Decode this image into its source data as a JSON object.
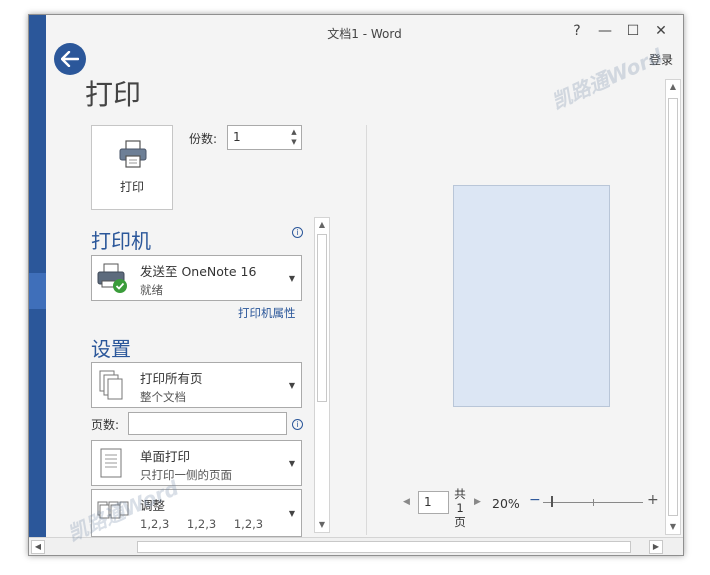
{
  "window": {
    "title": "文档1 - Word",
    "login": "登录",
    "help": "?",
    "minimize": "—",
    "maximize": "☐",
    "close": "✕"
  },
  "page": {
    "title": "打印"
  },
  "print_button": {
    "label": "打印"
  },
  "copies": {
    "label": "份数:",
    "value": "1"
  },
  "printer": {
    "heading": "打印机",
    "name": "发送至 OneNote 16",
    "status": "就绪",
    "properties_link": "打印机属性"
  },
  "settings": {
    "heading": "设置",
    "range": {
      "title": "打印所有页",
      "subtitle": "整个文档"
    },
    "pages_label": "页数:",
    "pages_value": "",
    "sides": {
      "title": "单面打印",
      "subtitle": "只打印一侧的页面"
    },
    "collate": {
      "title": "调整",
      "subtitle_parts": [
        "1,2,3",
        "1,2,3",
        "1,2,3"
      ]
    }
  },
  "preview_nav": {
    "current_page": "1",
    "total_line1": "共",
    "total_line2": "1",
    "total_line3": "页",
    "zoom": "20%"
  },
  "watermarks": [
    "凯路通Word",
    "凯路通Word"
  ],
  "colors": {
    "accent": "#2b579a",
    "preview_page": "#dce6f4"
  },
  "icons": [
    "back-arrow-icon",
    "printer-icon",
    "onenote-printer-icon",
    "info-icon",
    "pages-icon",
    "single-sided-icon",
    "collate-icon"
  ]
}
